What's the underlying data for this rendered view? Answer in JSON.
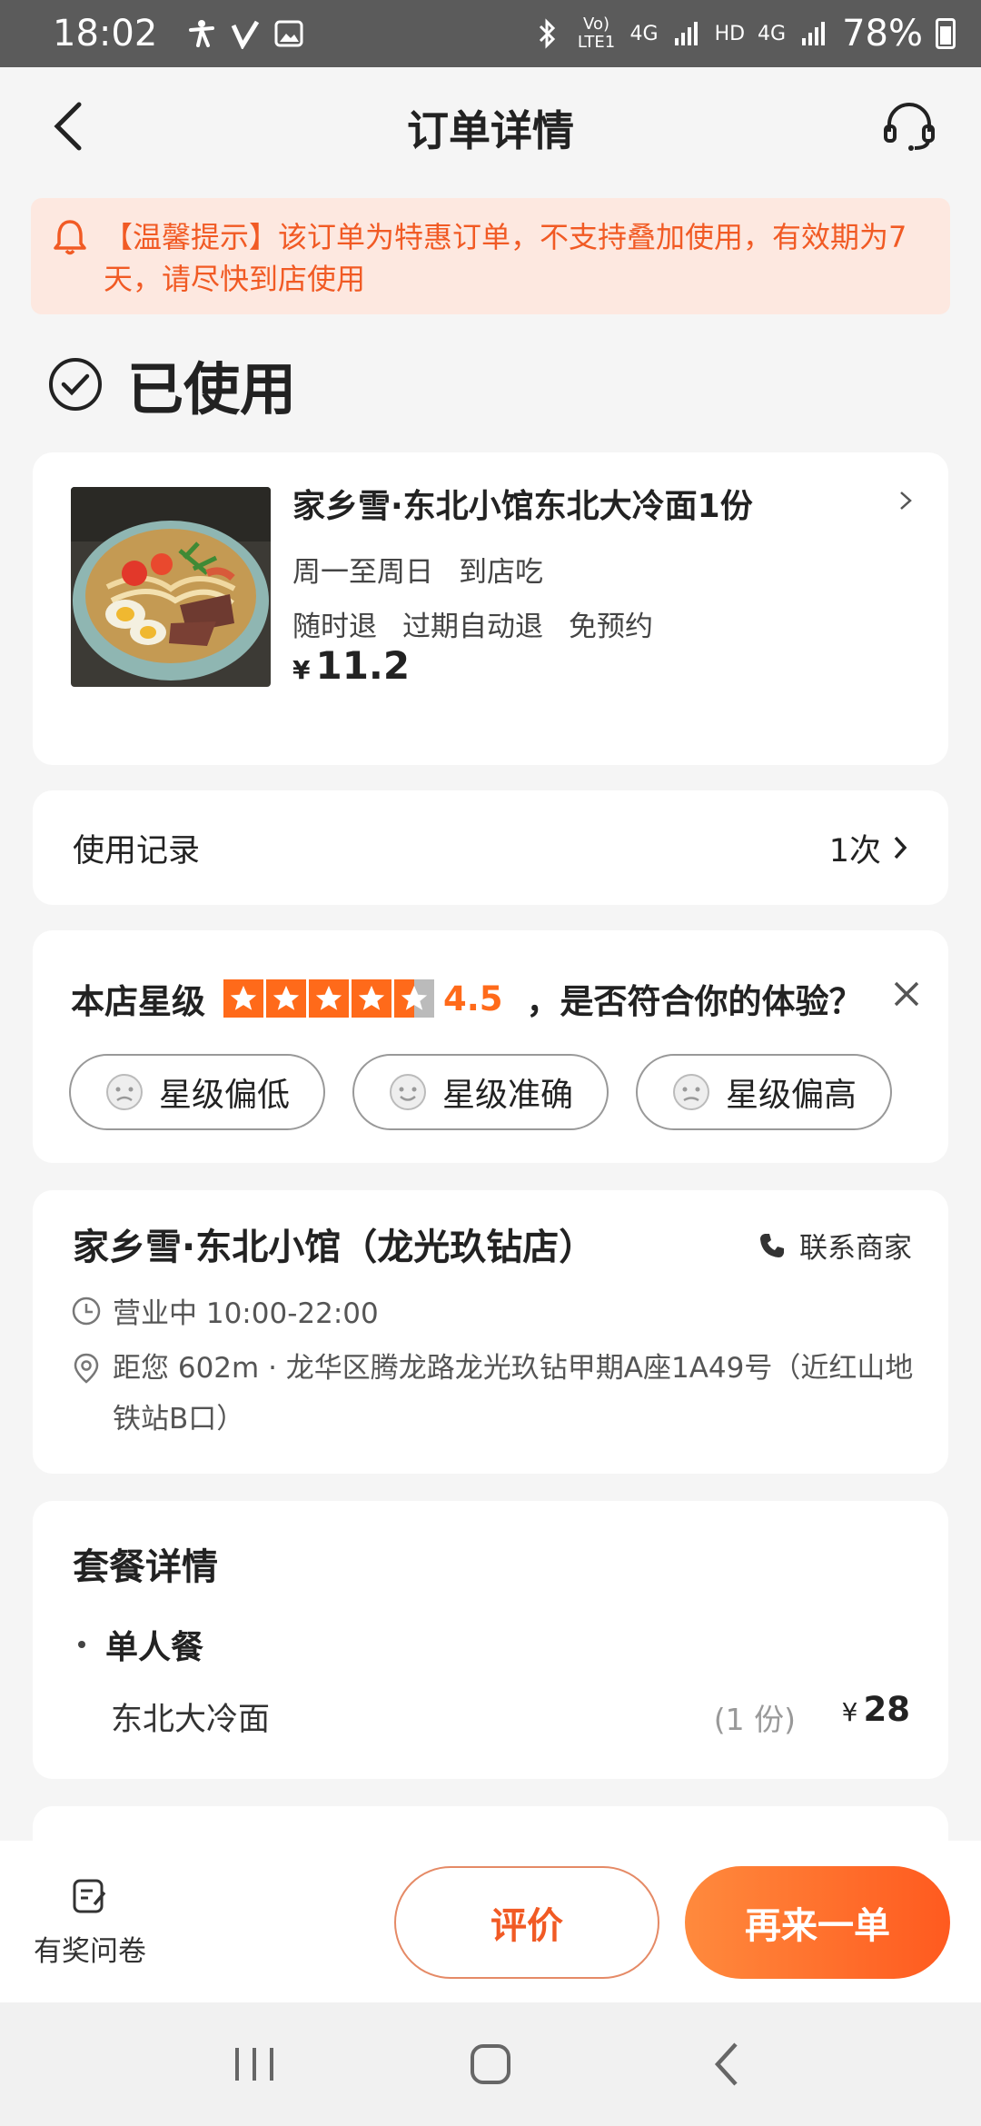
{
  "status_bar": {
    "time": "18:02",
    "battery": "78%",
    "network_labels": [
      "Vo) LTE1",
      "4G",
      "HD",
      "4G"
    ]
  },
  "header": {
    "title": "订单详情"
  },
  "notice": {
    "text": "【温馨提示】该订单为特惠订单，不支持叠加使用，有效期为7天，请尽快到店使用"
  },
  "order_status": {
    "text": "已使用"
  },
  "product": {
    "title": "家乡雪·东北小馆东北大冷面1份",
    "days": "周一至周日",
    "mode": "到店吃",
    "tags": [
      "随时退",
      "过期自动退",
      "免预约"
    ],
    "currency": "¥",
    "price": "11.2"
  },
  "usage": {
    "label": "使用记录",
    "count": "1次"
  },
  "rating": {
    "label": "本店星级",
    "stars_value": 4.5,
    "score": "4.5",
    "question": "，是否符合你的体验？",
    "options": [
      "星级偏低",
      "星级准确",
      "星级偏高"
    ]
  },
  "shop": {
    "name": "家乡雪·东北小馆（龙光玖钻店）",
    "contact_label": "联系商家",
    "hours": "营业中 10:00-22:00",
    "address": "距您 602m · 龙华区腾龙路龙光玖钻甲期A座1A49号（近红山地铁站B口）"
  },
  "package": {
    "title": "套餐详情",
    "group": "单人餐",
    "item": "东北大冷面",
    "qty": "(1 份)",
    "currency": "¥",
    "price": "28"
  },
  "bottom": {
    "survey_label": "有奖问卷",
    "review_label": "评价",
    "reorder_label": "再来一单"
  },
  "colors": {
    "accent": "#ff5a1f",
    "notice_bg": "#fde8e0",
    "star": "#ff6a1a"
  }
}
